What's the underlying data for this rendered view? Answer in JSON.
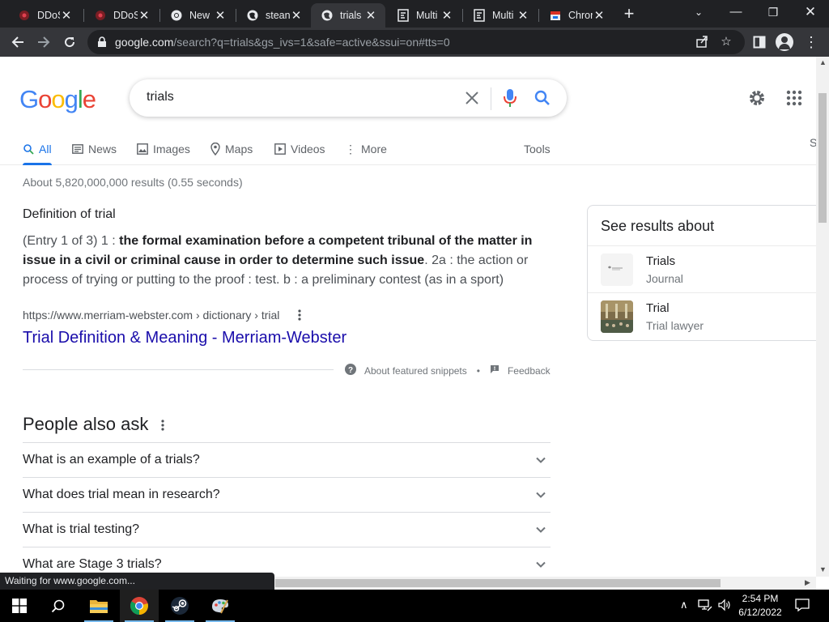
{
  "browser": {
    "tabs": [
      {
        "title": "DDoS",
        "icon": "ddos-favicon-icon"
      },
      {
        "title": "DDoS",
        "icon": "ddos-favicon-icon"
      },
      {
        "title": "New",
        "icon": "chrome-favicon-icon"
      },
      {
        "title": "stean",
        "icon": "globe-favicon-icon"
      },
      {
        "title": "trials",
        "icon": "globe-favicon-icon",
        "active": true
      },
      {
        "title": "Multi",
        "icon": "page-favicon-icon"
      },
      {
        "title": "Multi",
        "icon": "page-favicon-icon"
      },
      {
        "title": "Chron",
        "icon": "calendar-favicon-icon"
      }
    ],
    "url_host": "google.com",
    "url_path": "/search?q=trials&gs_ivs=1&safe=active&ssui=on#tts=0"
  },
  "search": {
    "query": "trials",
    "tabs": [
      "All",
      "News",
      "Images",
      "Maps",
      "Videos",
      "More"
    ],
    "tools_label": "Tools",
    "edge_letter": "S",
    "result_stats": "About 5,820,000,000 results (0.55 seconds)"
  },
  "snippet": {
    "heading": "Definition of trial",
    "prefix": "(Entry 1 of 3) 1 : ",
    "bold": "the formal examination before a competent tribunal of the matter in issue in a civil or criminal cause in order to determine such issue",
    "suffix": ". 2a : the action or process of trying or putting to the proof : test. b : a preliminary contest (as in a sport)",
    "cite": "https://www.merriam-webster.com › dictionary › trial",
    "title": "Trial Definition & Meaning - Merriam-Webster",
    "about_label": "About featured snippets",
    "separator": "•",
    "feedback_label": "Feedback"
  },
  "paa": {
    "title": "People also ask",
    "questions": [
      "What is an example of a trials?",
      "What does trial mean in research?",
      "What is trial testing?",
      "What are Stage 3 trials?"
    ]
  },
  "knowledge": {
    "title": "See results about",
    "items": [
      {
        "name": "Trials",
        "subtitle": "Journal"
      },
      {
        "name": "Trial",
        "subtitle": "Trial lawyer"
      }
    ]
  },
  "status_text": "Waiting for www.google.com...",
  "taskbar": {
    "time": "2:54 PM",
    "date": "6/12/2022"
  },
  "colors": {
    "link": "#1a0dab",
    "accent": "#1a73e8",
    "chrome_dark": "#202124",
    "chrome_toolbar": "#35363a"
  }
}
